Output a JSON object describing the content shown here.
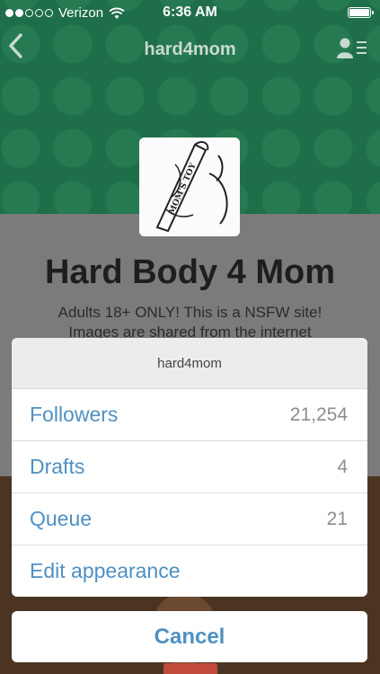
{
  "status_bar": {
    "carrier": "Verizon",
    "time": "6:36 AM",
    "signal_bars_filled": 2,
    "signal_bars_total": 5
  },
  "nav": {
    "back_icon": "chevron-left-icon",
    "title": "hard4mom",
    "menu_icon": "user-list-icon"
  },
  "blog": {
    "name": "Hard Body 4 Mom",
    "description_line1": "Adults 18+ ONLY! This is a NSFW site!",
    "description_line2": "Images are shared from the internet",
    "avatar_text": "MOM'S TOY"
  },
  "action_sheet": {
    "title": "hard4mom",
    "items": [
      {
        "label": "Followers",
        "count": "21,254"
      },
      {
        "label": "Drafts",
        "count": "4"
      },
      {
        "label": "Queue",
        "count": "21"
      },
      {
        "label": "Edit appearance",
        "count": ""
      }
    ],
    "cancel_label": "Cancel"
  },
  "colors": {
    "banner": "#1f6e4a",
    "accent": "#4f90c3",
    "overlay": "#7b7b7b"
  }
}
